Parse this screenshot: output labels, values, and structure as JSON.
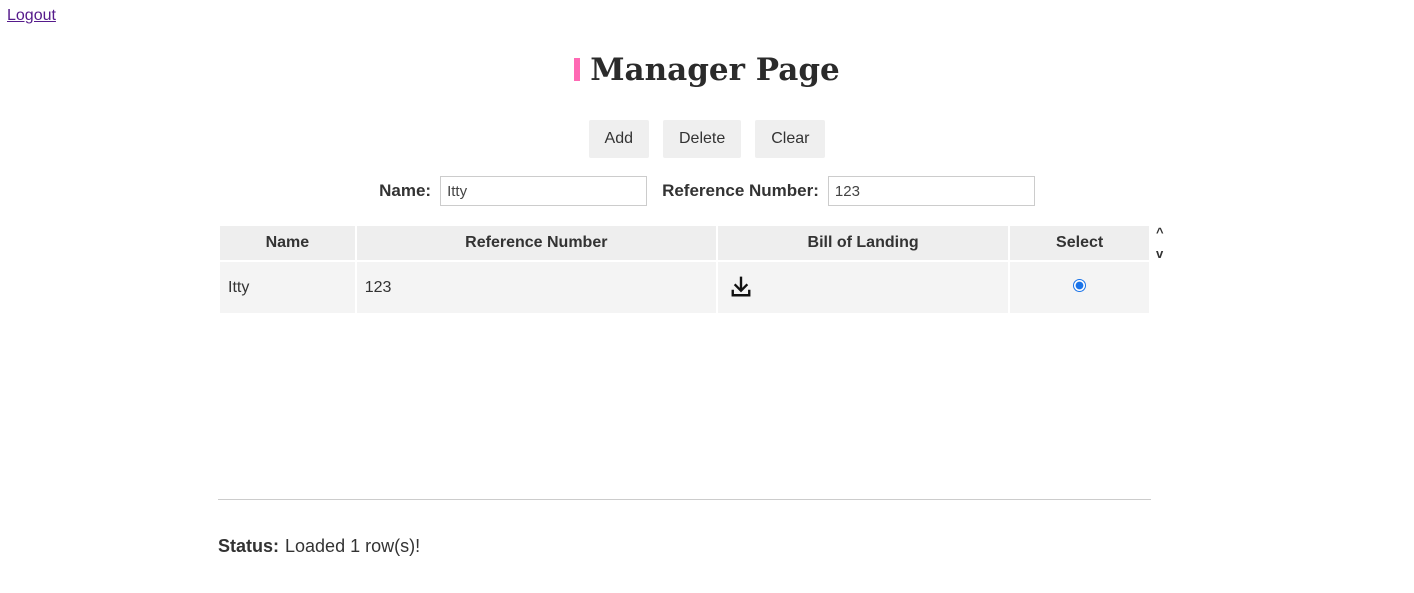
{
  "nav": {
    "logout_label": "Logout"
  },
  "page": {
    "title": "Manager Page",
    "accent_color": "#ff69b4"
  },
  "toolbar": {
    "add_label": "Add",
    "delete_label": "Delete",
    "clear_label": "Clear"
  },
  "form": {
    "name_label": "Name:",
    "name_value": "Itty",
    "reference_label": "Reference Number:",
    "reference_value": "123"
  },
  "table": {
    "columns": [
      "Name",
      "Reference Number",
      "Bill of Landing",
      "Select"
    ],
    "rows": [
      {
        "name": "Itty",
        "reference_number": "123",
        "bill_icon": "download-icon",
        "selected": true
      }
    ],
    "sort_up": "^",
    "sort_down": "v"
  },
  "status": {
    "label": "Status:",
    "message": "Loaded 1 row(s)!"
  }
}
